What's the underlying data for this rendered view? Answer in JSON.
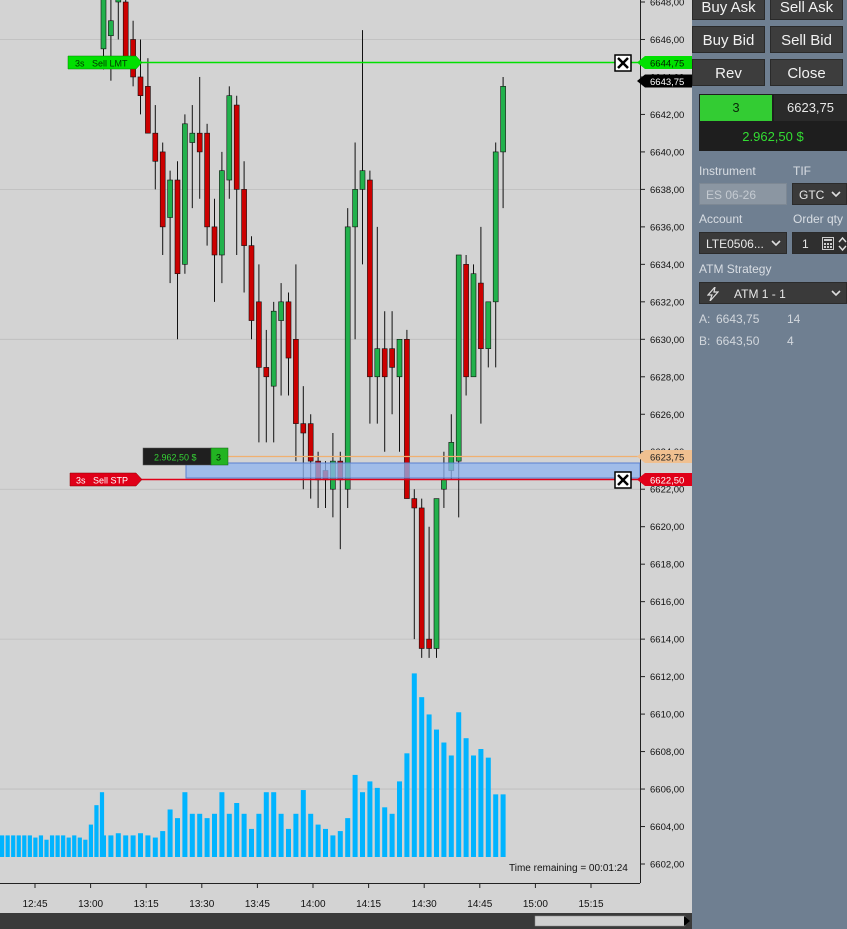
{
  "chart": {
    "price_axis_labels": [
      "6648,00",
      "6646,00",
      "6644,00",
      "6642,00",
      "6640,00",
      "6638,00",
      "6636,00",
      "6634,00",
      "6632,00",
      "6630,00",
      "6628,00",
      "6626,00",
      "6624,00",
      "6622,00",
      "6620,00",
      "6618,00",
      "6616,00",
      "6614,00",
      "6612,00",
      "6610,00",
      "6608,00",
      "6606,00",
      "6604,00",
      "6602,00"
    ],
    "time_axis_labels": [
      "12:45",
      "13:00",
      "13:15",
      "13:30",
      "13:45",
      "14:00",
      "14:15",
      "14:30",
      "14:45",
      "15:00",
      "15:15"
    ],
    "time_remaining": "Time remaining = 00:01:24",
    "sell_limit": {
      "tag_timeframe": "3s",
      "tag_label": "Sell LMT",
      "price_label": "6644,75",
      "color": "#00e000"
    },
    "last_price": {
      "price_label": "6643,75"
    },
    "position": {
      "pnl_label": "2.962,50 $",
      "qty_label": "3",
      "price_label": "6623,75",
      "color": "#f0b070"
    },
    "sell_stop": {
      "tag_timeframe": "3s",
      "tag_label": "Sell STP",
      "price_label": "6622,50",
      "color": "#e00018"
    },
    "close_order_icon": "close-x-icon",
    "volume_color": "#00b4ff",
    "up_color": "#22b14c",
    "down_color": "#cc0000"
  },
  "chart_data": {
    "type": "candlestick",
    "price_range": [
      6601,
      6648.5
    ],
    "volume_units": "relative",
    "candles": [
      {
        "o": 6645.5,
        "h": 6651,
        "l": 6644.4,
        "c": 6648.5,
        "v": 0.1
      },
      {
        "o": 6646.2,
        "h": 6649.5,
        "l": 6643.8,
        "c": 6647.0,
        "v": 0.1
      },
      {
        "o": 6648.0,
        "h": 6650.0,
        "l": 6646.0,
        "c": 6649.5,
        "v": 0.11
      },
      {
        "o": 6648.0,
        "h": 6650.0,
        "l": 6645.0,
        "c": 6645.0,
        "v": 0.1
      },
      {
        "o": 6646.0,
        "h": 6647.0,
        "l": 6643.5,
        "c": 6644.0,
        "v": 0.1
      },
      {
        "o": 6644.0,
        "h": 6646.0,
        "l": 6642.0,
        "c": 6643.0,
        "v": 0.11
      },
      {
        "o": 6643.5,
        "h": 6645.0,
        "l": 6641.0,
        "c": 6641.0,
        "v": 0.1
      },
      {
        "o": 6641.0,
        "h": 6642.5,
        "l": 6638.0,
        "c": 6639.5,
        "v": 0.09
      },
      {
        "o": 6640.0,
        "h": 6640.5,
        "l": 6634.5,
        "c": 6636.0,
        "v": 0.12
      },
      {
        "o": 6636.5,
        "h": 6639.0,
        "l": 6633.0,
        "c": 6638.5,
        "v": 0.22
      },
      {
        "o": 6638.5,
        "h": 6639.5,
        "l": 6630.0,
        "c": 6633.5,
        "v": 0.18
      },
      {
        "o": 6634.0,
        "h": 6642.0,
        "l": 6633.5,
        "c": 6641.5,
        "v": 0.3
      },
      {
        "o": 6640.5,
        "h": 6642.5,
        "l": 6637.0,
        "c": 6641.0,
        "v": 0.2
      },
      {
        "o": 6641.0,
        "h": 6644.0,
        "l": 6637.5,
        "c": 6640.0,
        "v": 0.2
      },
      {
        "o": 6641.0,
        "h": 6641.5,
        "l": 6635.0,
        "c": 6636.0,
        "v": 0.18
      },
      {
        "o": 6636.0,
        "h": 6637.5,
        "l": 6632.0,
        "c": 6634.5,
        "v": 0.2
      },
      {
        "o": 6634.5,
        "h": 6640.0,
        "l": 6633.0,
        "c": 6639.0,
        "v": 0.3
      },
      {
        "o": 6638.5,
        "h": 6643.5,
        "l": 6637.5,
        "c": 6643.0,
        "v": 0.2
      },
      {
        "o": 6642.5,
        "h": 6643.0,
        "l": 6634.5,
        "c": 6638.0,
        "v": 0.25
      },
      {
        "o": 6638.0,
        "h": 6639.5,
        "l": 6632.5,
        "c": 6635.0,
        "v": 0.2
      },
      {
        "o": 6635.0,
        "h": 6635.5,
        "l": 6630.0,
        "c": 6631.0,
        "v": 0.13
      },
      {
        "o": 6632.0,
        "h": 6634.0,
        "l": 6624.5,
        "c": 6628.5,
        "v": 0.2
      },
      {
        "o": 6628.5,
        "h": 6630.5,
        "l": 6624.5,
        "c": 6628.0,
        "v": 0.3
      },
      {
        "o": 6627.5,
        "h": 6632.0,
        "l": 6624.5,
        "c": 6631.5,
        "v": 0.3
      },
      {
        "o": 6631.0,
        "h": 6633.0,
        "l": 6627.0,
        "c": 6632.0,
        "v": 0.2
      },
      {
        "o": 6632.0,
        "h": 6632.5,
        "l": 6627.0,
        "c": 6629.0,
        "v": 0.13
      },
      {
        "o": 6630.0,
        "h": 6634.0,
        "l": 6623.5,
        "c": 6625.5,
        "v": 0.2
      },
      {
        "o": 6625.5,
        "h": 6627.5,
        "l": 6622.0,
        "c": 6625.0,
        "v": 0.31
      },
      {
        "o": 6625.5,
        "h": 6626.0,
        "l": 6621.5,
        "c": 6623.5,
        "v": 0.2
      },
      {
        "o": 6623.5,
        "h": 6624.0,
        "l": 6621.0,
        "c": 6622.5,
        "v": 0.15
      },
      {
        "o": 6623.0,
        "h": 6623.5,
        "l": 6621.0,
        "c": 6622.5,
        "v": 0.13
      },
      {
        "o": 6622.0,
        "h": 6625.0,
        "l": 6620.5,
        "c": 6623.5,
        "v": 0.1
      },
      {
        "o": 6623.5,
        "h": 6624.0,
        "l": 6618.8,
        "c": 6622.5,
        "v": 0.12
      },
      {
        "o": 6622.0,
        "h": 6637.0,
        "l": 6621.0,
        "c": 6636.0,
        "v": 0.18
      },
      {
        "o": 6636.0,
        "h": 6640.5,
        "l": 6630.0,
        "c": 6638.0,
        "v": 0.38
      },
      {
        "o": 6638.0,
        "h": 6646.5,
        "l": 6634.0,
        "c": 6639.0,
        "v": 0.3
      },
      {
        "o": 6638.5,
        "h": 6639.0,
        "l": 6625.5,
        "c": 6628.0,
        "v": 0.35
      },
      {
        "o": 6628.0,
        "h": 6636.0,
        "l": 6625.5,
        "c": 6629.5,
        "v": 0.32
      },
      {
        "o": 6629.5,
        "h": 6631.5,
        "l": 6624.0,
        "c": 6628.0,
        "v": 0.23
      },
      {
        "o": 6629.5,
        "h": 6631.5,
        "l": 6626.0,
        "c": 6628.5,
        "v": 0.2
      },
      {
        "o": 6628.0,
        "h": 6630.0,
        "l": 6624.0,
        "c": 6630.0,
        "v": 0.35
      },
      {
        "o": 6630.0,
        "h": 6630.5,
        "l": 6621.5,
        "c": 6621.5,
        "v": 0.48
      },
      {
        "o": 6621.5,
        "h": 6622.0,
        "l": 6614.0,
        "c": 6621.0,
        "v": 0.85
      },
      {
        "o": 6621.0,
        "h": 6621.5,
        "l": 6613.0,
        "c": 6613.5,
        "v": 0.74
      },
      {
        "o": 6614.0,
        "h": 6620.0,
        "l": 6613.0,
        "c": 6613.5,
        "v": 0.66
      },
      {
        "o": 6613.5,
        "h": 6621.5,
        "l": 6613.0,
        "c": 6621.5,
        "v": 0.59
      },
      {
        "o": 6622.0,
        "h": 6624.0,
        "l": 6621.0,
        "c": 6622.5,
        "v": 0.53
      },
      {
        "o": 6623.0,
        "h": 6626.0,
        "l": 6622.5,
        "c": 6624.5,
        "v": 0.47
      },
      {
        "o": 6623.5,
        "h": 6634.5,
        "l": 6620.5,
        "c": 6634.5,
        "v": 0.67
      },
      {
        "o": 6634.0,
        "h": 6634.5,
        "l": 6627.0,
        "c": 6628.0,
        "v": 0.55
      },
      {
        "o": 6628.0,
        "h": 6634.0,
        "l": 6629.0,
        "c": 6633.5,
        "v": 0.47
      },
      {
        "o": 6633.0,
        "h": 6636.0,
        "l": 6625.5,
        "c": 6629.5,
        "v": 0.5
      },
      {
        "o": 6629.5,
        "h": 6632.0,
        "l": 6628.5,
        "c": 6632.0,
        "v": 0.46
      },
      {
        "o": 6632.0,
        "h": 6640.5,
        "l": 6628.5,
        "c": 6640.0,
        "v": 0.29
      },
      {
        "o": 6640.0,
        "h": 6644.0,
        "l": 6637.0,
        "c": 6643.5,
        "v": 0.29
      }
    ]
  },
  "panel": {
    "buttons": {
      "buy_ask": "Buy Ask",
      "sell_ask": "Sell Ask",
      "buy_bid": "Buy Bid",
      "sell_bid": "Sell Bid",
      "rev": "Rev",
      "close": "Close"
    },
    "position_qty": "3",
    "position_avg_price": "6623,75",
    "unrealized_pnl": "2.962,50 $",
    "instrument_label": "Instrument",
    "tif_label": "TIF",
    "instrument_value": "ES 06-26",
    "tif_value": "GTC",
    "account_label": "Account",
    "order_qty_label": "Order qty",
    "account_value": "LTE0506...",
    "order_qty_value": "1",
    "atm_strategy_label": "ATM Strategy",
    "atm_strategy_value": "ATM 1 - 1",
    "ask_label": "A:",
    "ask_price": "6643,75",
    "ask_size": "14",
    "bid_label": "B:",
    "bid_price": "6643,50",
    "bid_size": "4"
  }
}
